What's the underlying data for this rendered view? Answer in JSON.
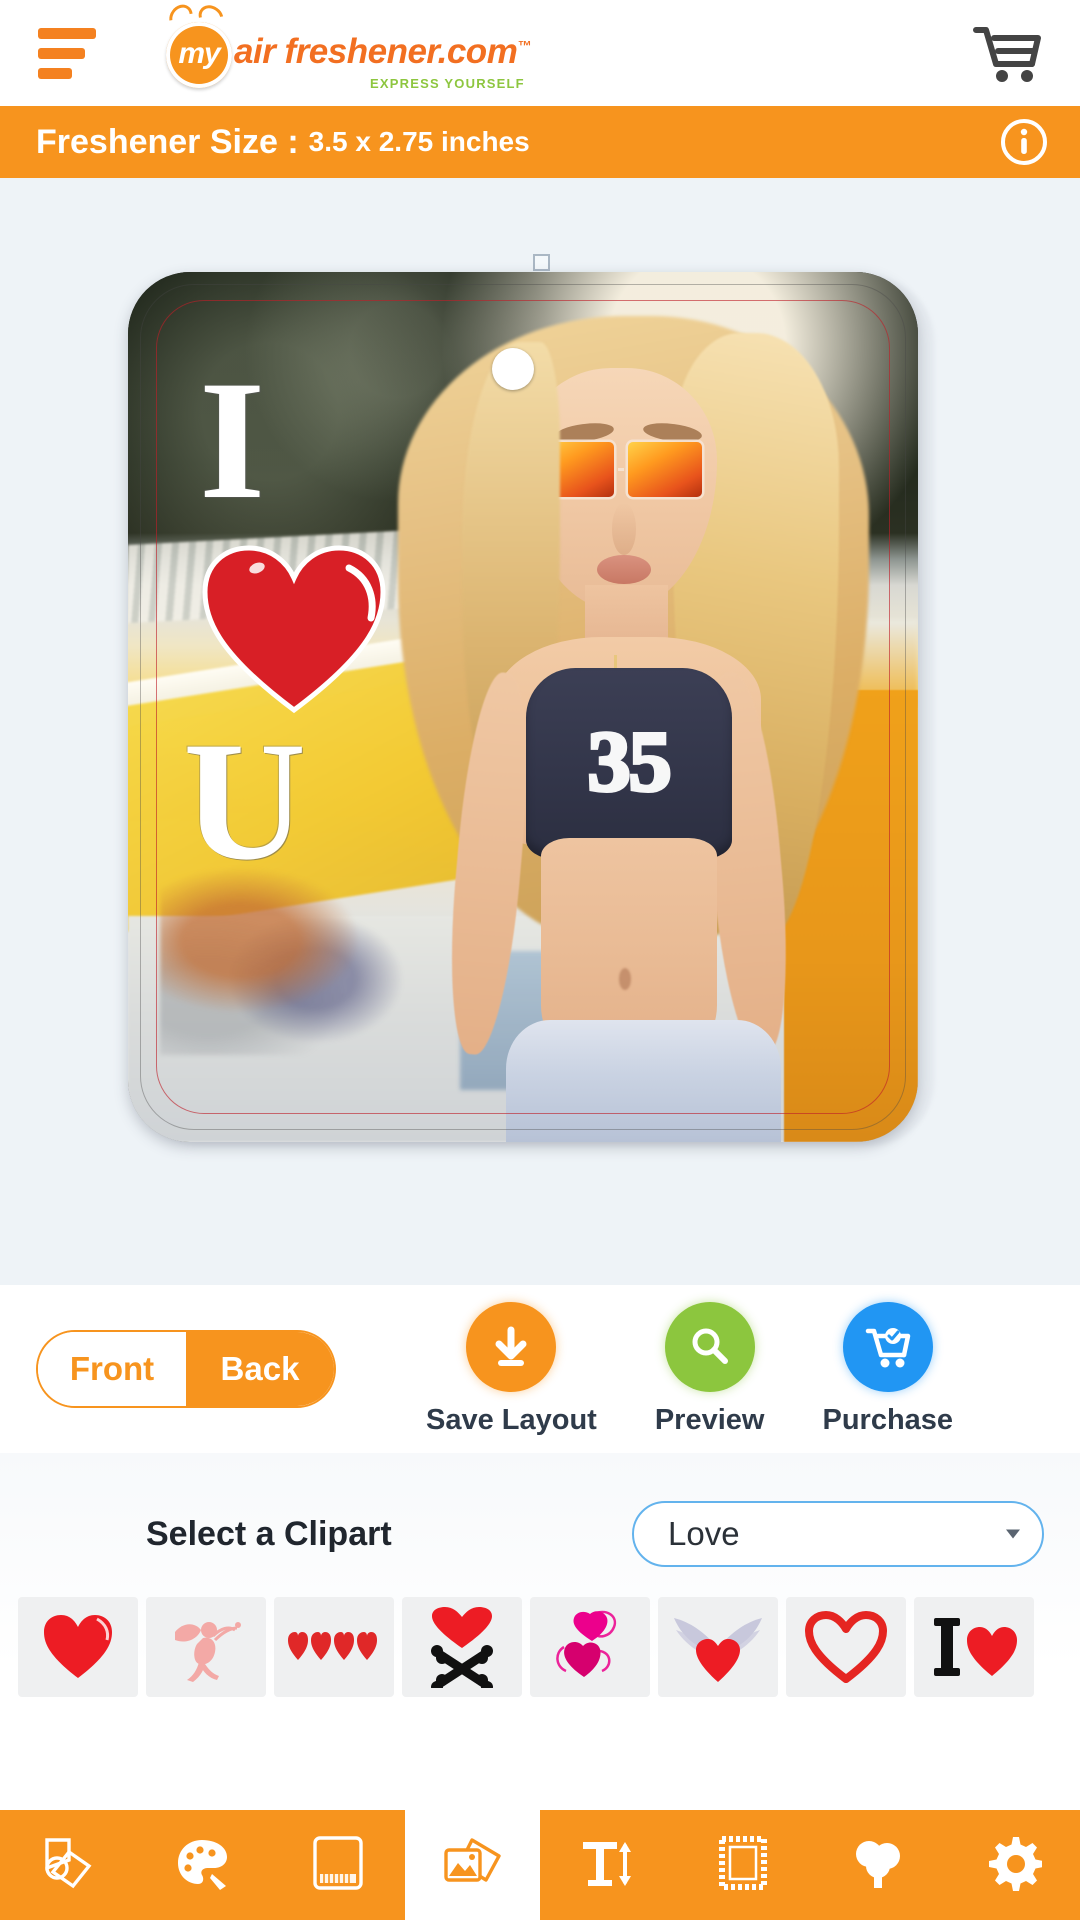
{
  "header": {
    "menu_icon": "hamburger-menu-icon",
    "logo": {
      "badge_text": "my",
      "main_text": "air freshener.com",
      "trademark": "™",
      "tagline": "EXPRESS YOURSELF"
    },
    "cart_icon": "shopping-cart-icon"
  },
  "size_bar": {
    "label": "Freshener Size :",
    "value": "3.5 x 2.75 inches",
    "info_icon": "info-icon",
    "background_color": "#F7941E"
  },
  "canvas": {
    "overlay_text_top": "I",
    "overlay_text_bottom": "U",
    "overlay_heart": "heart-clipart",
    "shirt_number": "35",
    "selection_handle": "rotate-handle",
    "top_handle": "resize-handle"
  },
  "actions": {
    "toggle": {
      "front_label": "Front",
      "back_label": "Back",
      "selected": "Back"
    },
    "buttons": [
      {
        "label": "Save Layout",
        "icon": "download-icon",
        "color": "#F7941E"
      },
      {
        "label": "Preview",
        "icon": "magnifier-icon",
        "color": "#8CC63E"
      },
      {
        "label": "Purchase",
        "icon": "cart-check-icon",
        "color": "#2196F3"
      }
    ]
  },
  "clipart": {
    "title": "Select a Clipart",
    "selected_category": "Love",
    "categories": [
      "Love"
    ],
    "items": [
      {
        "name": "solid-heart-clipart"
      },
      {
        "name": "cupid-clipart"
      },
      {
        "name": "four-small-hearts-clipart"
      },
      {
        "name": "heart-crossbones-clipart"
      },
      {
        "name": "pink-double-heart-clipart"
      },
      {
        "name": "winged-heart-clipart"
      },
      {
        "name": "heart-outline-clipart"
      },
      {
        "name": "i-heart-clipart"
      }
    ]
  },
  "toolbar": {
    "items": [
      {
        "name": "shapes-icon",
        "active": false
      },
      {
        "name": "palette-icon",
        "active": false
      },
      {
        "name": "background-icon",
        "active": false
      },
      {
        "name": "clipart-images-icon",
        "active": true
      },
      {
        "name": "text-icon",
        "active": false
      },
      {
        "name": "frame-icon",
        "active": false
      },
      {
        "name": "scent-tree-icon",
        "active": false
      },
      {
        "name": "settings-gear-icon",
        "active": false
      }
    ],
    "background_color": "#F7941E"
  }
}
